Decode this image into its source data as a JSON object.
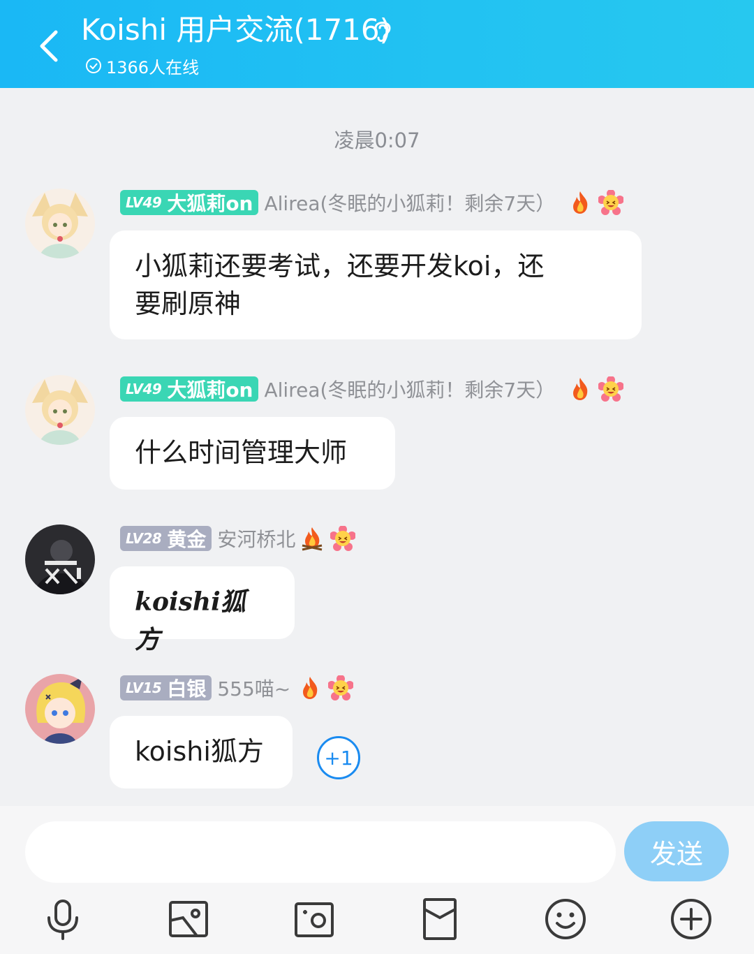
{
  "header": {
    "title": "Koishi 用户交流(1716)",
    "online": "1366人在线"
  },
  "timestamp": "凌晨0:07",
  "messages": [
    {
      "level": "LV49",
      "badge_title": "大狐莉on",
      "badge_color": "#3ad6b4",
      "nickname": "Alirea(冬眠的小狐莉！剩余7天）",
      "text_line1": "小狐莉还要考试，还要开发koi，还",
      "text_line2": "要刷原神"
    },
    {
      "level": "LV49",
      "badge_title": "大狐莉on",
      "badge_color": "#3ad6b4",
      "nickname": "Alirea(冬眠的小狐莉！剩余7天）",
      "text": "什么时间管理大师"
    },
    {
      "level": "LV28",
      "badge_title": "黄金",
      "badge_color": "#a9adc0",
      "nickname": "安河桥北",
      "text": "koishi狐方"
    },
    {
      "level": "LV15",
      "badge_title": "白银",
      "badge_color": "#a9adc0",
      "nickname": "555喵~",
      "text": "koishi狐方",
      "reaction": "+1"
    }
  ],
  "composer": {
    "placeholder": "",
    "send_label": "发送"
  },
  "toolbar": [
    "microphone-icon",
    "image-icon",
    "camera-icon",
    "red-packet-icon",
    "smile-icon",
    "plus-icon"
  ],
  "colors": {
    "header_start": "#1ab8f5",
    "header_end": "#27c8ef",
    "send_button": "#8ecff7",
    "accent_blue": "#1a8bf0"
  }
}
